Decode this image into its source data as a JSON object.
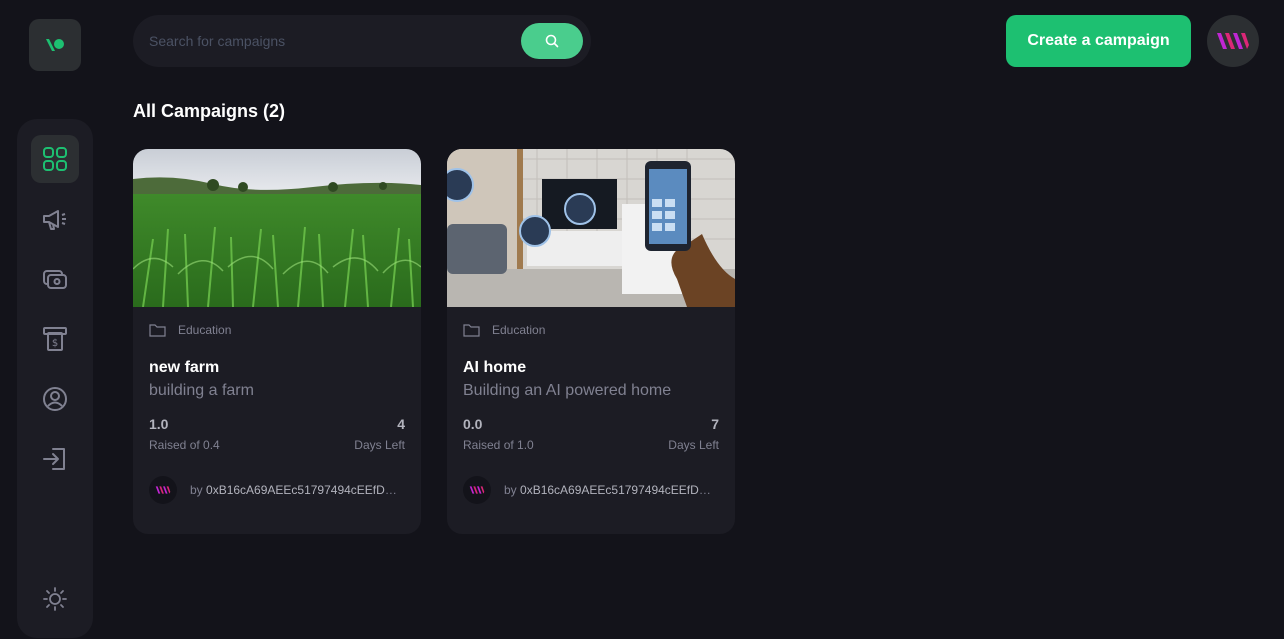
{
  "brand": {
    "logo_icon": "logo-mark",
    "accent": "#1dc071",
    "search_accent": "#4acd8d"
  },
  "sidebar": {
    "items": [
      {
        "icon": "dashboard-icon",
        "active": true
      },
      {
        "icon": "campaign-megaphone-icon",
        "active": false
      },
      {
        "icon": "payment-icon",
        "active": false
      },
      {
        "icon": "withdraw-icon",
        "active": false
      },
      {
        "icon": "profile-icon",
        "active": false
      },
      {
        "icon": "logout-icon",
        "active": false
      }
    ],
    "theme_toggle_icon": "sun-icon"
  },
  "search": {
    "placeholder": "Search for campaigns",
    "value": "",
    "button_icon": "search-icon"
  },
  "header": {
    "create_label": "Create a campaign",
    "avatar_icon": "user-avatar-logo"
  },
  "section": {
    "title": "All Campaigns (2)"
  },
  "campaigns": [
    {
      "category": "Education",
      "title": "new farm",
      "description": "building a farm",
      "raised": "1.0",
      "raised_label": "Raised of 0.4",
      "days": "4",
      "days_label": "Days Left",
      "owner_prefix": "by ",
      "owner": "0xB16cA69AEEc51797494cEEfD1c..."
    },
    {
      "category": "Education",
      "title": "AI home",
      "description": "Building an AI powered home",
      "raised": "0.0",
      "raised_label": "Raised of 1.0",
      "days": "7",
      "days_label": "Days Left",
      "owner_prefix": "by ",
      "owner": "0xB16cA69AEEc51797494cEEfD1c..."
    }
  ]
}
